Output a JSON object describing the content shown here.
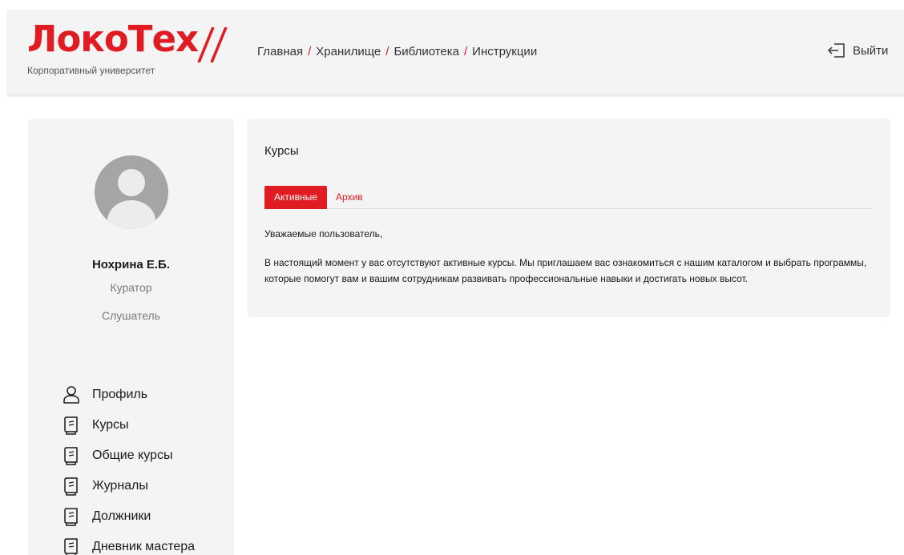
{
  "brand": {
    "name": "ЛокоТех",
    "subtitle": "Корпоративный университет",
    "accent_color": "#e01b22"
  },
  "nav": {
    "items": [
      {
        "label": "Главная"
      },
      {
        "label": "Хранилище"
      },
      {
        "label": "Библиотека"
      },
      {
        "label": "Инструкции"
      }
    ],
    "separator": "/"
  },
  "header": {
    "logout_label": "Выйти",
    "logout_icon": "logout-icon"
  },
  "user": {
    "name": "Нохрина Е.Б.",
    "roles": [
      "Куратор",
      "Слушатель"
    ],
    "avatar_icon": "user-avatar-placeholder"
  },
  "sidebar": {
    "items": [
      {
        "label": "Профиль",
        "icon": "user-icon"
      },
      {
        "label": "Курсы",
        "icon": "book-icon"
      },
      {
        "label": "Общие курсы",
        "icon": "book-icon"
      },
      {
        "label": "Журналы",
        "icon": "book-icon"
      },
      {
        "label": "Должники",
        "icon": "book-icon"
      },
      {
        "label": "Дневник мастера",
        "icon": "book-icon"
      }
    ]
  },
  "main": {
    "title": "Курсы",
    "tabs": [
      {
        "label": "Активные",
        "active": true
      },
      {
        "label": "Архив",
        "active": false
      }
    ],
    "greeting": "Уважаемые пользователь,",
    "message": "В настоящий момент у вас отсутствуют активные курсы. Мы приглашаем вас ознакомиться с нашим каталогом и выбрать программы, которые помогут вам и вашим сотрудникам развивать профессиональные навыки и достигать новых высот."
  }
}
